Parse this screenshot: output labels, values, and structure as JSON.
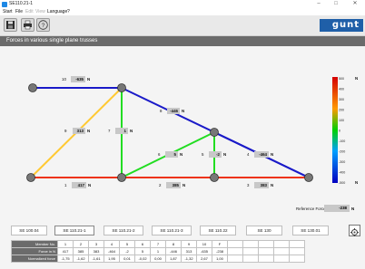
{
  "window": {
    "title": "SE110.21-1",
    "minimize": "–",
    "maximize": "□",
    "close": "✕"
  },
  "menu": [
    "Start",
    "File",
    "Edit",
    "View",
    "Language",
    "?"
  ],
  "toolbar": {
    "icons": [
      "save-icon",
      "print-icon",
      "help-icon"
    ],
    "help_glyph": "?"
  },
  "logo": {
    "text": "gunt"
  },
  "heading": "Forces in various single plane trusses",
  "truss": {
    "unit": "N",
    "members": [
      {
        "no": "10",
        "value": "-635"
      },
      {
        "no": "9",
        "value": "313"
      },
      {
        "no": "7",
        "value": "1"
      },
      {
        "no": "8",
        "value": "-446"
      },
      {
        "no": "6",
        "value": "5"
      },
      {
        "no": "5",
        "value": "-2"
      },
      {
        "no": "4",
        "value": "-464"
      },
      {
        "no": "1",
        "value": "417"
      },
      {
        "no": "2",
        "value": "385"
      },
      {
        "no": "3",
        "value": "383"
      }
    ]
  },
  "legend": {
    "unit": "N",
    "ticks": [
      "500",
      "400",
      "300",
      "200",
      "100",
      "0",
      "-100",
      "-200",
      "-300",
      "-400",
      "-500"
    ]
  },
  "reference": {
    "label": "Reference Force F",
    "value": "-238",
    "unit": "N"
  },
  "tabs": [
    {
      "label": "SE 100.04",
      "active": false
    },
    {
      "label": "SE 110.21-1",
      "active": true
    },
    {
      "label": "SE 110.21-2",
      "active": false
    },
    {
      "label": "SE 110.21-3",
      "active": false
    },
    {
      "label": "SE 110.22",
      "active": false
    },
    {
      "label": "SE 130",
      "active": false
    },
    {
      "label": "SE 130.01",
      "active": false
    }
  ],
  "table": {
    "row_headers": [
      "Member No.",
      "Force in N",
      "Normalized force"
    ],
    "member_no": [
      "1",
      "2",
      "3",
      "4",
      "5",
      "6",
      "7",
      "8",
      "9",
      "10",
      "F",
      "",
      "",
      "",
      "",
      ""
    ],
    "force": [
      "417",
      "385",
      "383",
      "-464",
      "-2",
      "5",
      "1",
      "-446",
      "313",
      "-635",
      "-238",
      "",
      "",
      "",
      "",
      ""
    ],
    "normalized": [
      "-1,75",
      "-1,62",
      "-1,61",
      "1,95",
      "0,01",
      "-0,02",
      "0,00",
      "1,87",
      "-1,32",
      "2,67",
      "1,00",
      "",
      "",
      "",
      "",
      ""
    ]
  }
}
